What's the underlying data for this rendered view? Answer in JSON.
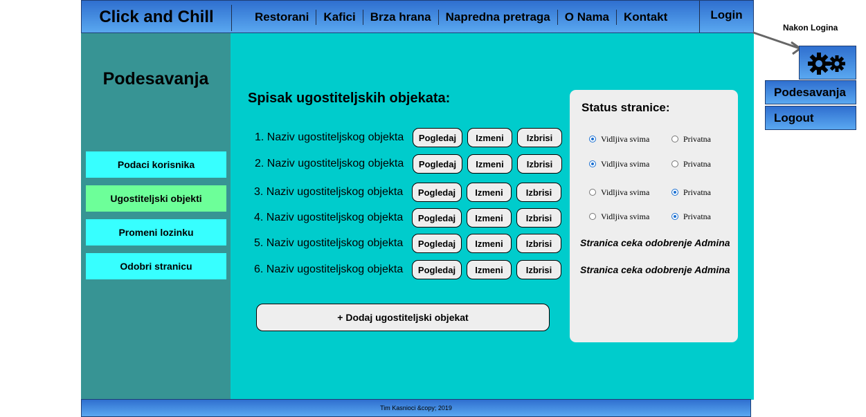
{
  "header": {
    "brand": "Click and Chill",
    "nav": [
      "Restorani",
      "Kafici",
      "Brza hrana",
      "Napredna pretraga",
      "O Nama",
      "Kontakt"
    ],
    "login": "Login"
  },
  "sidebar": {
    "title": "Podesavanja",
    "items": [
      "Podaci korisnika",
      "Ugostiteljski objekti",
      "Promeni lozinku",
      "Odobri stranicu"
    ],
    "active_index": 1
  },
  "main": {
    "list_title": "Spisak ugostiteljskih objekata:",
    "rows": [
      {
        "label": "1. Naziv ugostiteljskog objekta"
      },
      {
        "label": "2. Naziv ugostiteljskog objekta"
      },
      {
        "label": "3. Naziv ugostiteljskog objekta"
      },
      {
        "label": "4. Naziv ugostiteljskog objekta"
      },
      {
        "label": "5. Naziv ugostiteljskog objekta"
      },
      {
        "label": "6. Naziv ugostiteljskog objekta"
      }
    ],
    "row_buttons": {
      "view": "Pogledaj",
      "edit": "Izmeni",
      "delete": "Izbrisi"
    },
    "add_button": "+ Dodaj ugostiteljski objekat"
  },
  "status": {
    "title": "Status stranice:",
    "option_visible": "Vidljiva svima",
    "option_private": "Privatna",
    "selections": [
      "visible",
      "visible",
      "private",
      "private"
    ],
    "pending_text": "Stranica ceka odobrenje Admina",
    "pending_count": 2
  },
  "footer": {
    "text": "Tim Kasnioci &copy; 2019"
  },
  "annotation": {
    "after_login_label": "Nakon Logina",
    "menu": [
      "Podesavanja",
      "Logout"
    ],
    "icon": "gears-icon"
  },
  "colors": {
    "header_gradient_top": "#2f6fcf",
    "header_gradient_bottom": "#5aa8f0",
    "sidebar_bg": "#379494",
    "main_bg": "#00cccc",
    "side_button": "#37ffff",
    "side_button_active": "#6dff99",
    "panel_bg": "#eeeeee"
  }
}
